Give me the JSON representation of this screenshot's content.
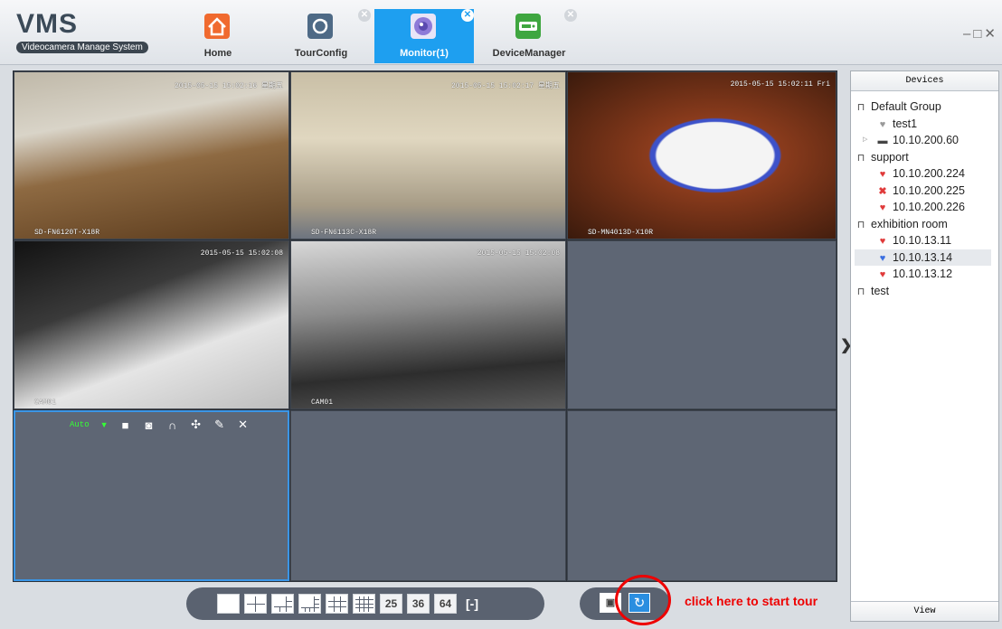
{
  "app": {
    "title": "VMS",
    "subtitle": "Videocamera Manage System"
  },
  "tabs": [
    {
      "label": "Home",
      "icon": "home-icon",
      "color": "#f06a2f"
    },
    {
      "label": "TourConfig",
      "icon": "refresh-icon",
      "color": "#4e6a86"
    },
    {
      "label": "Monitor(1)",
      "icon": "camera-lens-icon",
      "color": "#8e7ad8",
      "active": true
    },
    {
      "label": "DeviceManager",
      "icon": "device-icon",
      "color": "#3fa640"
    }
  ],
  "window_controls": {
    "minimize": "–",
    "maximize": "□",
    "close": "✕"
  },
  "cells": [
    {
      "timestamp": "2015-05-15 15:02:16 星期五",
      "camera": "SD-FN6120T-X18R"
    },
    {
      "timestamp": "2015-05-15 15:02:17 星期五",
      "camera": "SD-FN6113C-X18R"
    },
    {
      "timestamp": "2015-05-15 15:02:11 Fri",
      "camera": "SD-MN4013D-X10R"
    },
    {
      "timestamp": "2015-05-15 15:02:08",
      "camera": "CAM01"
    },
    {
      "timestamp": "2015-05-15 15:02:08",
      "camera": "CAM01"
    }
  ],
  "cell_toolbar": {
    "stream": "Auto"
  },
  "devices_panel": {
    "header": "Devices",
    "footer": "View",
    "tree": [
      {
        "label": "Default Group",
        "type": "group"
      },
      {
        "label": "test1",
        "type": "device"
      },
      {
        "label": "10.10.200.60",
        "type": "nvr"
      },
      {
        "label": "support",
        "type": "group"
      },
      {
        "label": "10.10.200.224",
        "type": "device"
      },
      {
        "label": "10.10.200.225",
        "type": "offline"
      },
      {
        "label": "10.10.200.226",
        "type": "device"
      },
      {
        "label": "exhibition room",
        "type": "group"
      },
      {
        "label": "10.10.13.11",
        "type": "device"
      },
      {
        "label": "10.10.13.14",
        "type": "device-active"
      },
      {
        "label": "10.10.13.12",
        "type": "device"
      },
      {
        "label": "test",
        "type": "group"
      }
    ]
  },
  "layout_buttons": [
    "25",
    "36",
    "64"
  ],
  "annotation": {
    "hint": "click here to start tour",
    "color": "#e00000"
  }
}
